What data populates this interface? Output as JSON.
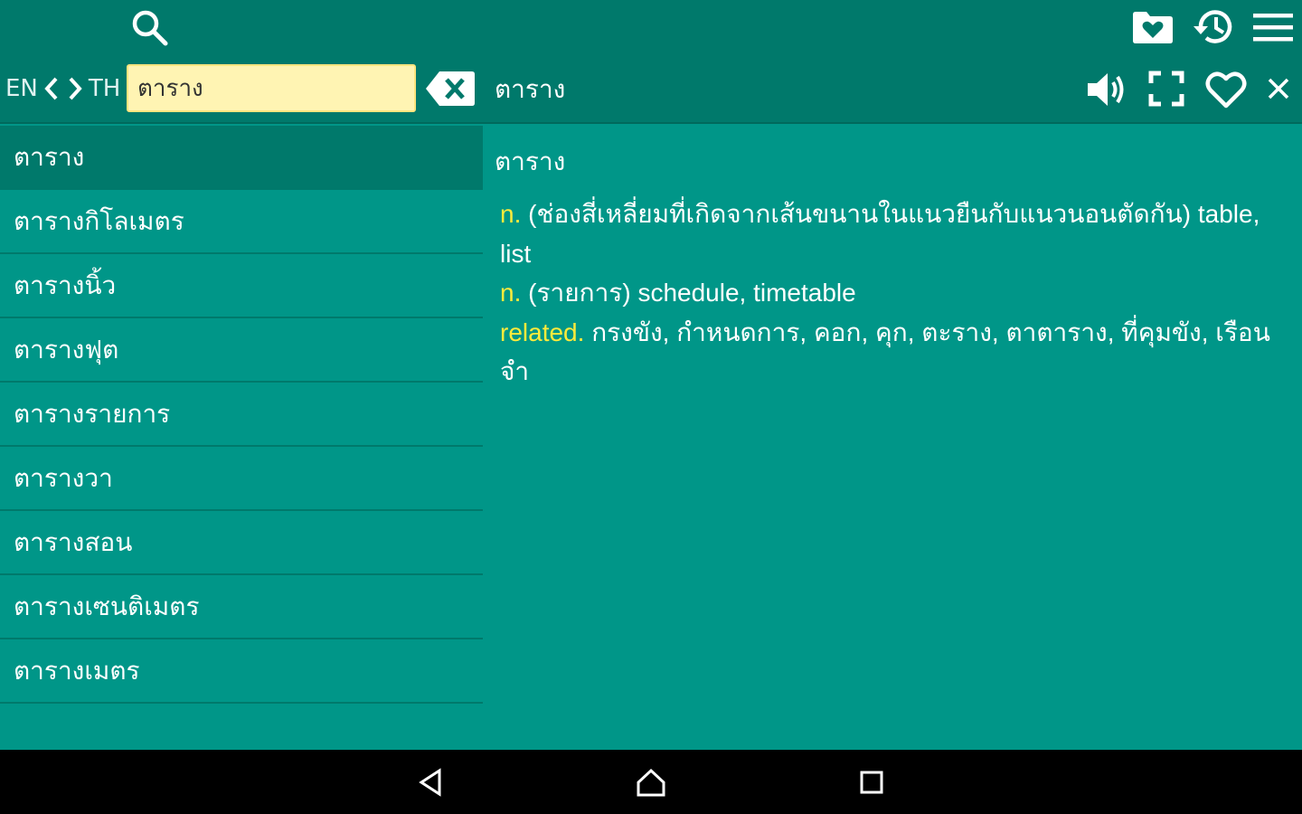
{
  "toolbar": {
    "search_icon": "search-icon",
    "favorites_folder_icon": "folder-heart-icon",
    "history_icon": "history-icon",
    "menu_icon": "hamburger-menu-icon"
  },
  "lang": {
    "from": "EN",
    "to": "TH"
  },
  "search": {
    "value": "ตาราง"
  },
  "header": {
    "word": "ตาราง"
  },
  "word_list": [
    "ตาราง",
    "ตารางกิโลเมตร",
    "ตารางนิ้ว",
    "ตารางฟุต",
    "ตารางรายการ",
    "ตารางวา",
    "ตารางสอน",
    "ตารางเซนติเมตร",
    "ตารางเมตร"
  ],
  "detail": {
    "title": "ตาราง",
    "entries": [
      {
        "pos": "n.",
        "text": "(ช่องสี่เหลี่ยมที่เกิดจากเส้นขนานในแนวยืนกับแนวนอนตัดกัน) table, list"
      },
      {
        "pos": "n.",
        "text": "(รายการ) schedule, timetable"
      },
      {
        "pos": "related.",
        "text": "กรงขัง, กำหนดการ, คอก, คุก, ตะราง, ตาตาราง, ที่คุมขัง, เรือนจำ"
      }
    ]
  },
  "colors": {
    "topbar": "#00796b",
    "background": "#009688",
    "accent": "#ffeb3b",
    "search_bg": "#fff4b3"
  }
}
